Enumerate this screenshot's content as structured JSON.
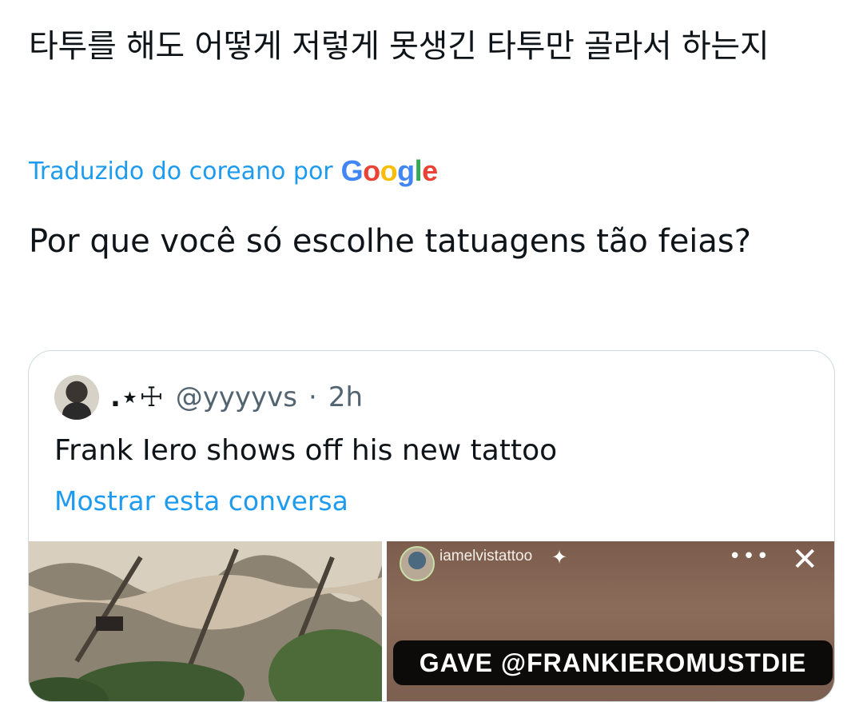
{
  "tweet": {
    "text": "타투를 해도 어떻게 저렇게 못생긴 타투만 골라서 하는지",
    "translated_label": "Traduzido do coreano por",
    "translation_provider": "Google",
    "translation": "Por que você só escolhe tatuagens tão feias?"
  },
  "quote": {
    "display_name": ".⋆☩",
    "handle": "@yyyyvs",
    "separator": "·",
    "time": "2h",
    "text": "Frank Iero shows off his new tattoo",
    "show_thread": "Mostrar esta conversa"
  },
  "media": {
    "story_username": "iamelvistattoo",
    "story_more": "•••",
    "story_close": "✕",
    "banner_text": "GAVE @FRANKIEROMUSTDIE"
  },
  "colors": {
    "link_blue": "#1d9bf0",
    "secondary_text": "#536471",
    "border": "#cfd9de"
  }
}
